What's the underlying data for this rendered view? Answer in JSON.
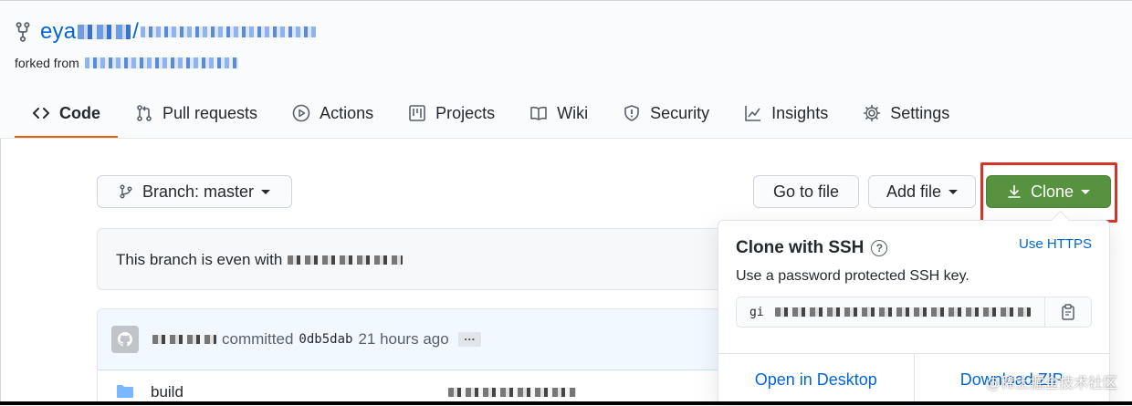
{
  "repo": {
    "owner_prefix": "eya",
    "forked_label": "forked from"
  },
  "tabs": [
    {
      "label": "Code",
      "icon": "code-icon",
      "active": true
    },
    {
      "label": "Pull requests",
      "icon": "pull-request-icon"
    },
    {
      "label": "Actions",
      "icon": "play-icon"
    },
    {
      "label": "Projects",
      "icon": "project-icon"
    },
    {
      "label": "Wiki",
      "icon": "book-icon"
    },
    {
      "label": "Security",
      "icon": "shield-icon"
    },
    {
      "label": "Insights",
      "icon": "graph-icon"
    },
    {
      "label": "Settings",
      "icon": "gear-icon"
    }
  ],
  "toolbar": {
    "branch_label": "Branch: master",
    "goto_label": "Go to file",
    "addfile_label": "Add file",
    "clone_label": "Clone",
    "clone_color": "#56923f"
  },
  "branch_status": {
    "text": "This branch is even with"
  },
  "commit": {
    "action": "committed",
    "sha": "0db5dab",
    "time": "21 hours ago",
    "more": "…"
  },
  "files": [
    {
      "name": "build",
      "type": "folder"
    }
  ],
  "clone_dropdown": {
    "title": "Clone with SSH",
    "help": "?",
    "alt_link": "Use HTTPS",
    "subtitle": "Use a password protected SSH key.",
    "url_prefix": "gi",
    "footer": {
      "open_desktop": "Open in Desktop",
      "download_zip": "Download ZIP"
    }
  },
  "watermark": "@稀土掘金技术社区",
  "colors": {
    "link": "#0366d6",
    "active_tab_border": "#e36209",
    "highlight": "#d53228"
  }
}
